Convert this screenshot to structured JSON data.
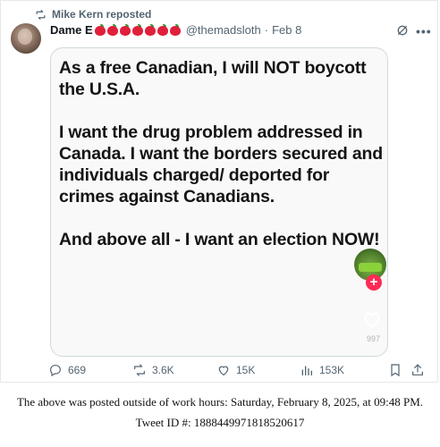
{
  "repost": {
    "text": "Mike Kern reposted",
    "icon": "repost-icon"
  },
  "author": {
    "display_name": "Dame E",
    "emoji_count": 7,
    "handle": "@themadsloth",
    "separator": "·",
    "date": "Feb 8"
  },
  "post": {
    "text": "As a free Canadian, I will NOT boycott the U.S.A.\n\nI want the drug problem addressed in Canada. I want the borders secured and individuals charged/ deported for crimes against Canadians.\n\nAnd above all - I want an election NOW!",
    "overlay_count": "997"
  },
  "actions": {
    "replies": "669",
    "reposts": "3.6K",
    "likes": "15K",
    "views": "153K"
  },
  "footer": {
    "line1": "The above was posted outside of work hours: Saturday, February 8, 2025, at 09:48 PM.",
    "line2": "Tweet ID #: 1888449971818520617"
  },
  "colors": {
    "muted": "#536471",
    "badge": "#ff2b55",
    "apple": "#e0203b"
  }
}
